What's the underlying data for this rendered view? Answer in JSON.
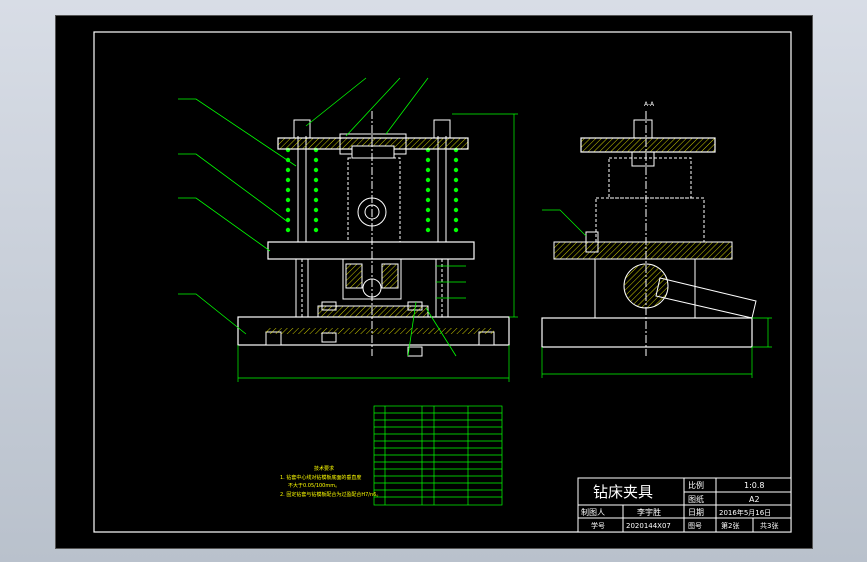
{
  "title_block": {
    "drawing_title": "钻床夹具",
    "scale_label": "比例",
    "scale_value": "1:0.8",
    "sheet_label": "图纸",
    "sheet_value": "A2",
    "drawer_label": "制图人",
    "drawer_name": "李宇胜",
    "date_label": "日期",
    "date_value": "2016年5月16日",
    "student_no_label": "学号",
    "student_no_value": "2020144X07",
    "drawing_no_label": "图号",
    "sheet_count": "第2张",
    "total_count": "共3张"
  },
  "views": {
    "side_view_label": "A-A"
  },
  "notes": {
    "heading": "技术要求",
    "line1": "1. 钻套中心线对钻模板底面的垂直度",
    "line1b": "不大于0.05/100mm。",
    "line2": "2. 固定钻套与钻模板配合为过盈配合H7/n6。"
  },
  "colors": {
    "background": "#000000",
    "frame": "#ffffff",
    "part_line": "#ffffff",
    "dimension": "#00ff00",
    "hatch": "#ffff00",
    "spring": "#00ff00"
  }
}
